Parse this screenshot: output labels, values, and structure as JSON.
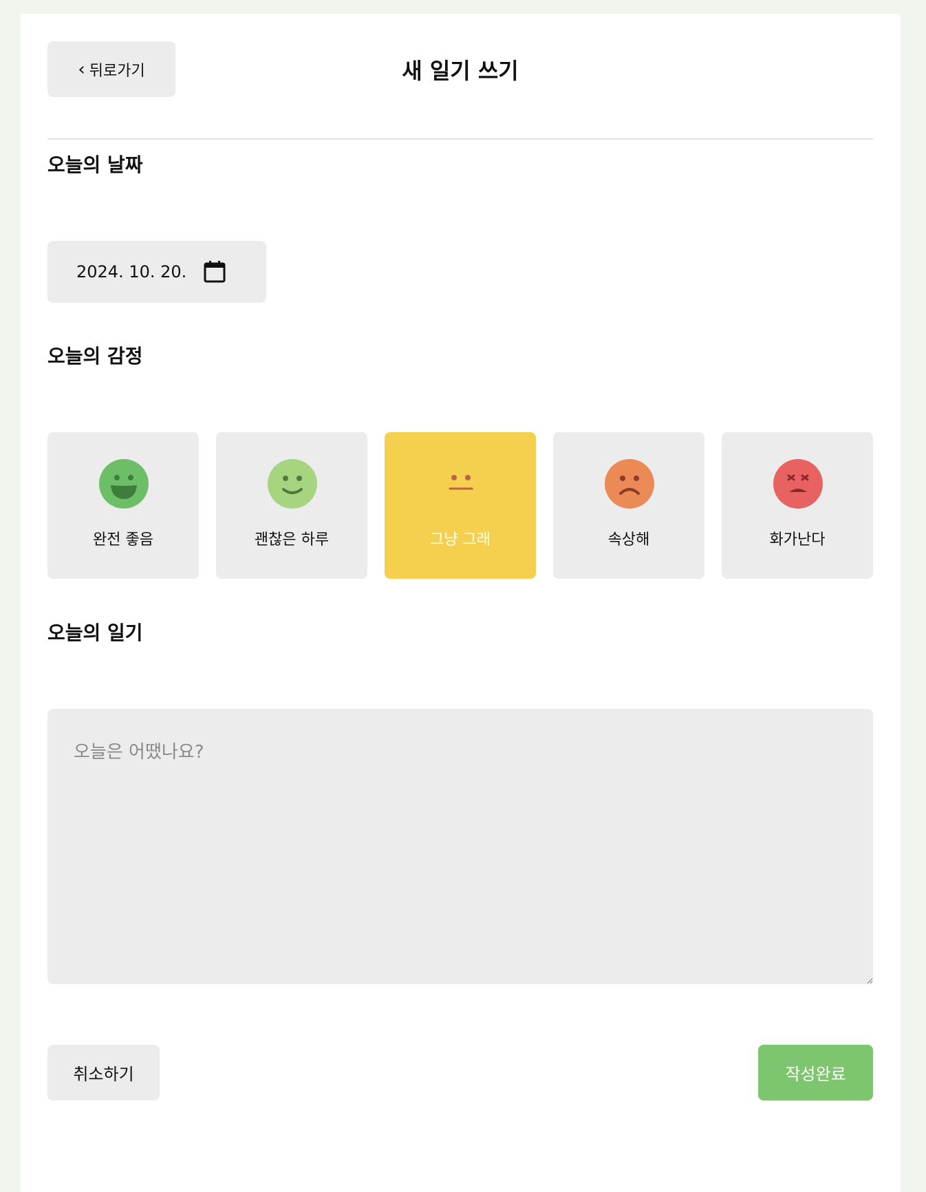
{
  "header": {
    "back_label": "뒤로가기",
    "back_icon": "chevron-left-icon",
    "title": "새 일기 쓰기"
  },
  "date_section": {
    "title": "오늘의 날짜",
    "date_value": "2024. 10. 20.",
    "icon": "calendar-icon"
  },
  "emotion_section": {
    "title": "오늘의 감정",
    "selected": "그냥 그래",
    "items": [
      {
        "label": "완전 좋음",
        "icon": "very-happy-face-icon",
        "color": "#6cbf67"
      },
      {
        "label": "괜찮은 하루",
        "icon": "smiling-face-icon",
        "color": "#a6d47f"
      },
      {
        "label": "그냥 그래",
        "icon": "neutral-face-icon",
        "color": "#f5cf4e"
      },
      {
        "label": "속상해",
        "icon": "sad-face-icon",
        "color": "#ec8a56"
      },
      {
        "label": "화가난다",
        "icon": "angry-face-icon",
        "color": "#e86262"
      }
    ]
  },
  "diary_section": {
    "title": "오늘의 일기",
    "placeholder": "오늘은 어땠나요?",
    "value": ""
  },
  "footer": {
    "cancel_label": "취소하기",
    "submit_label": "작성완료",
    "submit_color": "#7ec56f"
  }
}
